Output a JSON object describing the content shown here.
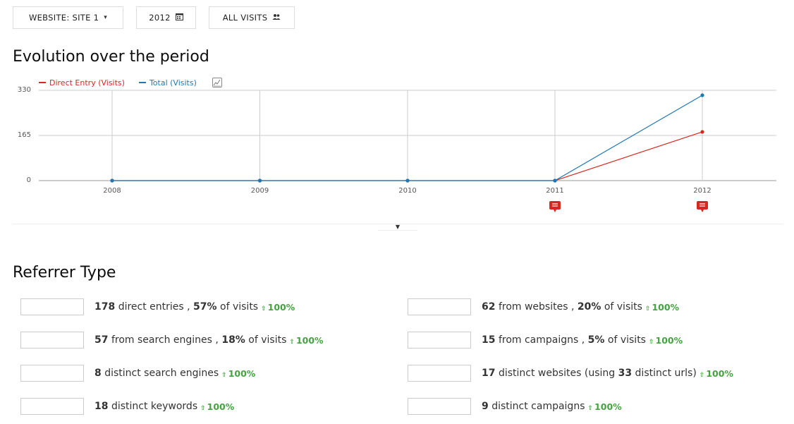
{
  "toolbar": {
    "site_label": "WEBSITE: SITE 1",
    "period_label": "2012",
    "segment_label": "ALL VISITS",
    "caret_icon": "caret-down-icon",
    "calendar_icon": "calendar-icon",
    "users_icon": "users-icon"
  },
  "evolution": {
    "title": "Evolution over the period"
  },
  "chart_data": {
    "type": "line",
    "x": [
      "2008",
      "2009",
      "2010",
      "2011",
      "2012"
    ],
    "y_ticks": [
      "330",
      "165",
      "0"
    ],
    "ylim": [
      0,
      330
    ],
    "grid": true,
    "legend_placement": "top-left",
    "series": [
      {
        "name": "Direct Entry (Visits)",
        "color": "#d4291f",
        "values": [
          0,
          0,
          0,
          0,
          178
        ]
      },
      {
        "name": "Total (Visits)",
        "color": "#1f78b4",
        "values": [
          0,
          0,
          0,
          0,
          312
        ]
      }
    ],
    "annotation_markers": [
      "2011",
      "2012"
    ]
  },
  "referrer": {
    "title": "Referrer Type",
    "trend_color": "#44a340",
    "left": [
      {
        "value": "178",
        "text": "direct entries ,",
        "pct": "57%",
        "suffix": "of visits",
        "trend": "100%"
      },
      {
        "value": "57",
        "text": "from search engines ,",
        "pct": "18%",
        "suffix": "of visits",
        "trend": "100%"
      },
      {
        "value": "8",
        "text": "distinct search engines",
        "trend": "100%"
      },
      {
        "value": "18",
        "text": "distinct keywords",
        "trend": "100%"
      }
    ],
    "right": [
      {
        "value": "62",
        "text": "from websites ,",
        "pct": "20%",
        "suffix": "of visits",
        "trend": "100%"
      },
      {
        "value": "15",
        "text": "from campaigns ,",
        "pct": "5%",
        "suffix": "of visits",
        "trend": "100%"
      },
      {
        "value": "17",
        "text": "distinct websites (using",
        "value2": "33",
        "text2": "distinct urls)",
        "trend": "100%"
      },
      {
        "value": "9",
        "text": "distinct campaigns",
        "trend": "100%"
      }
    ]
  }
}
